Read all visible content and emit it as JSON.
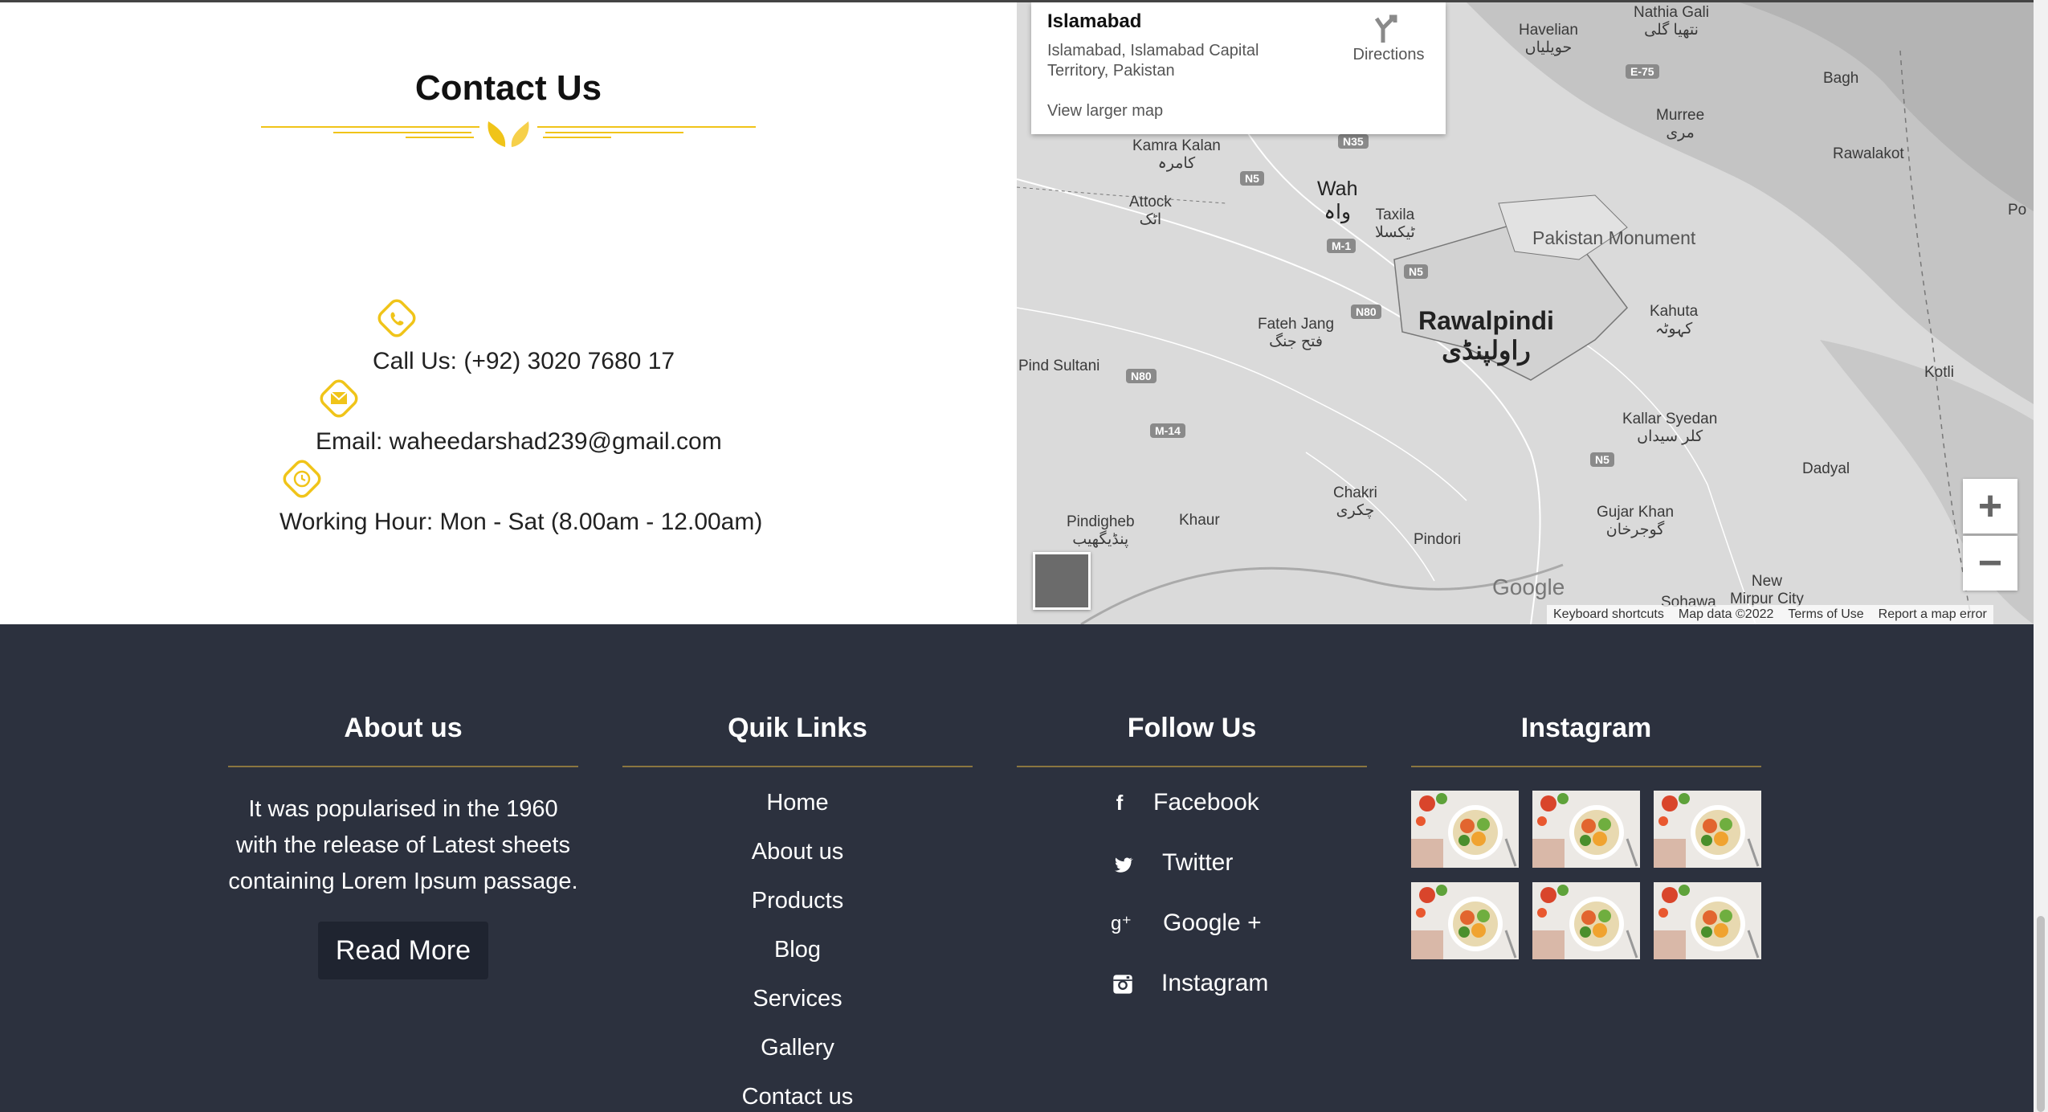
{
  "contact": {
    "title": "Contact Us",
    "items": [
      {
        "icon": "phone-icon",
        "text": "Call Us: (+92) 3020 7680 17"
      },
      {
        "icon": "envelope-icon",
        "text": "Email: waheedarshad239@gmail.com"
      },
      {
        "icon": "clock-icon",
        "text": "Working Hour: Mon - Sat (8.00am - 12.00am)"
      }
    ],
    "accent_color": "#f0c419"
  },
  "map": {
    "card": {
      "title": "Islamabad",
      "address": "Islamabad, Islamabad Capital Territory, Pakistan",
      "link": "View larger map",
      "directions": "Directions"
    },
    "labels": {
      "havelian": "Havelian\nحویلیاں",
      "nathia": "Nathia Gali\nنتھیا گلی",
      "bagh": "Bagh",
      "murree": "Murree\nمری",
      "rawalakot": "Rawalakot",
      "po": "Po",
      "kamra": "Kamra Kalan\nکامرہ",
      "wah": "Wah\nواہ",
      "attock": "Attock\nاٹک",
      "taxila": "Taxila\nٹیکسلا",
      "monument": "Pakistan Monument",
      "rawalpindi": "Rawalpindi\nراولپنڈی",
      "fateh": "Fateh Jang\nفتح جنگ",
      "kahuta": "Kahuta\nکہوٹہ",
      "pind": "Pind Sultani",
      "kotli": "Kotli",
      "kallar": "Kallar Syedan\nکلر سیداں",
      "dadyal": "Dadyal",
      "chakri": "Chakri\nچکری",
      "pindigheb": "Pindigheb\nپنڈیگھیب",
      "khaur": "Khaur",
      "pindori": "Pindori",
      "gujar": "Gujar Khan\nگوجرخان",
      "mirpur": "New\nMirpur City",
      "sohawa": "Sohawa"
    },
    "roads": {
      "e75": "E-75",
      "n35": "N35",
      "n5a": "N5",
      "m1": "M-1",
      "n5b": "N5",
      "n80a": "N80",
      "n80b": "N80",
      "m14": "M-14",
      "n5c": "N5"
    },
    "zoom_in": "+",
    "zoom_out": "−",
    "google": "Google",
    "attribution": [
      "Keyboard shortcuts",
      "Map data ©2022",
      "Terms of Use",
      "Report a map error"
    ]
  },
  "footer": {
    "about": {
      "title": "About us",
      "text": "It was popularised in the 1960 with the release of Latest sheets containing Lorem Ipsum passage.",
      "button": "Read More"
    },
    "links": {
      "title": "Quik Links",
      "items": [
        "Home",
        "About us",
        "Products",
        "Blog",
        "Services",
        "Gallery",
        "Contact us"
      ]
    },
    "follow": {
      "title": "Follow Us",
      "items": [
        {
          "icon": "facebook-icon",
          "label": "Facebook"
        },
        {
          "icon": "twitter-icon",
          "label": "Twitter"
        },
        {
          "icon": "google-plus-icon",
          "label": "Google +"
        },
        {
          "icon": "instagram-icon",
          "label": "Instagram"
        }
      ]
    },
    "instagram": {
      "title": "Instagram",
      "count": 6
    },
    "background": "#2c313e",
    "rule_color": "#8a7640"
  }
}
